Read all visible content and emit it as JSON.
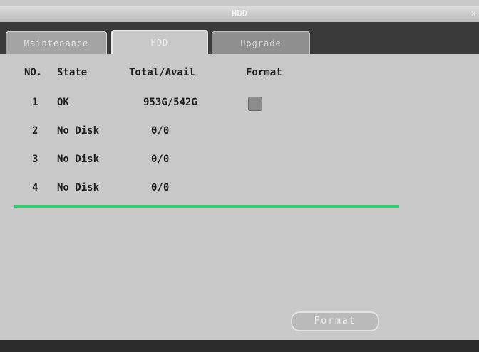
{
  "window": {
    "title": "HDD",
    "close_glyph": "×"
  },
  "tabs": [
    {
      "label": "Maintenance",
      "active": false
    },
    {
      "label": "HDD",
      "active": true
    },
    {
      "label": "Upgrade",
      "active": false
    }
  ],
  "table": {
    "headers": [
      "NO.",
      "State",
      "Total/Avail",
      "Format"
    ],
    "rows": [
      {
        "no": "1",
        "state": "OK",
        "size": "953G/542G",
        "format_checkbox": true
      },
      {
        "no": "2",
        "state": "No Disk",
        "size": "0/0"
      },
      {
        "no": "3",
        "state": "No Disk",
        "size": "0/0"
      },
      {
        "no": "4",
        "state": "No Disk",
        "size": "0/0"
      }
    ]
  },
  "progress": {
    "fraction": 1.0,
    "color": "#2ecf70"
  },
  "buttons": {
    "format_label": "Format"
  },
  "colors": {
    "window_bg": "#c8c8c8",
    "tabbar_bg": "#3a3a3a"
  }
}
